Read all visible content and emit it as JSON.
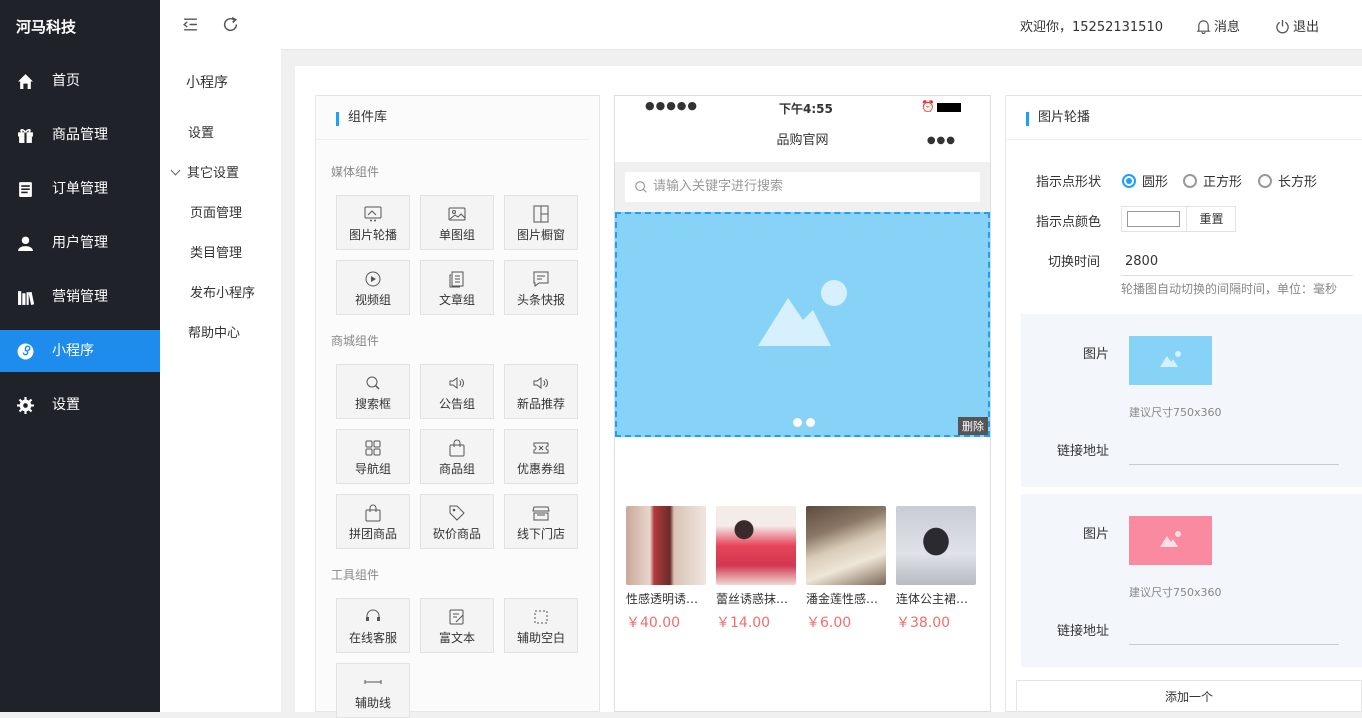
{
  "app": {
    "brand": "河马科技"
  },
  "sidebar": {
    "items": [
      {
        "label": "首页",
        "icon": "home-icon"
      },
      {
        "label": "商品管理",
        "icon": "gift-icon"
      },
      {
        "label": "订单管理",
        "icon": "order-icon"
      },
      {
        "label": "用户管理",
        "icon": "user-icon"
      },
      {
        "label": "营销管理",
        "icon": "books-icon"
      },
      {
        "label": "小程序",
        "icon": "miniprogram-icon",
        "active": true
      },
      {
        "label": "设置",
        "icon": "gear-icon"
      }
    ]
  },
  "subnav": {
    "title": "小程序",
    "items": [
      "设置",
      "其它设置",
      "页面管理",
      "类目管理",
      "发布小程序",
      "帮助中心"
    ]
  },
  "header": {
    "welcome": "欢迎你，15252131510",
    "messages": "消息",
    "logout": "退出"
  },
  "library": {
    "title": "组件库",
    "sections": [
      {
        "title": "媒体组件",
        "items": [
          "图片轮播",
          "单图组",
          "图片橱窗",
          "视频组",
          "文章组",
          "头条快报"
        ]
      },
      {
        "title": "商城组件",
        "items": [
          "搜索框",
          "公告组",
          "新品推荐",
          "导航组",
          "商品组",
          "优惠券组",
          "拼团商品",
          "砍价商品",
          "线下门店"
        ]
      },
      {
        "title": "工具组件",
        "items": [
          "在线客服",
          "富文本",
          "辅助空白",
          "辅助线"
        ]
      }
    ]
  },
  "phone": {
    "carrier_dots": "●●●●●",
    "time": "下午4:55",
    "title": "品购官网",
    "more": "●●●",
    "search_placeholder": "请输入关键字进行搜索",
    "delete_label": "删除",
    "banner_color": "#87d3f8",
    "products": [
      {
        "name": "性感透明诱惑睡衣",
        "price": "￥40.00"
      },
      {
        "name": "蕾丝诱惑抹胸睡裙",
        "price": "￥14.00"
      },
      {
        "name": "潘金莲性感睡衣",
        "price": "￥6.00"
      },
      {
        "name": "连体公主裙睡衣",
        "price": "￥38.00"
      }
    ]
  },
  "settings": {
    "title": "图片轮播",
    "indicator_shape_label": "指示点形状",
    "shapes": [
      "圆形",
      "正方形",
      "长方形"
    ],
    "selected_shape": "圆形",
    "indicator_color_label": "指示点颜色",
    "reset": "重置",
    "interval_label": "切换时间",
    "interval_value": "2800",
    "interval_hint": "轮播图自动切换的间隔时间，单位：毫秒",
    "slides": [
      {
        "image_label": "图片",
        "size_hint": "建议尺寸750x360",
        "link_label": "链接地址",
        "color": "#87d3f8"
      },
      {
        "image_label": "图片",
        "size_hint": "建议尺寸750x360",
        "link_label": "链接地址",
        "color": "#f98aa0"
      }
    ],
    "add_button": "添加一个"
  },
  "colors": {
    "accent": "#1e8ced",
    "price": "#f56c6c",
    "sidebar": "#20222a"
  }
}
